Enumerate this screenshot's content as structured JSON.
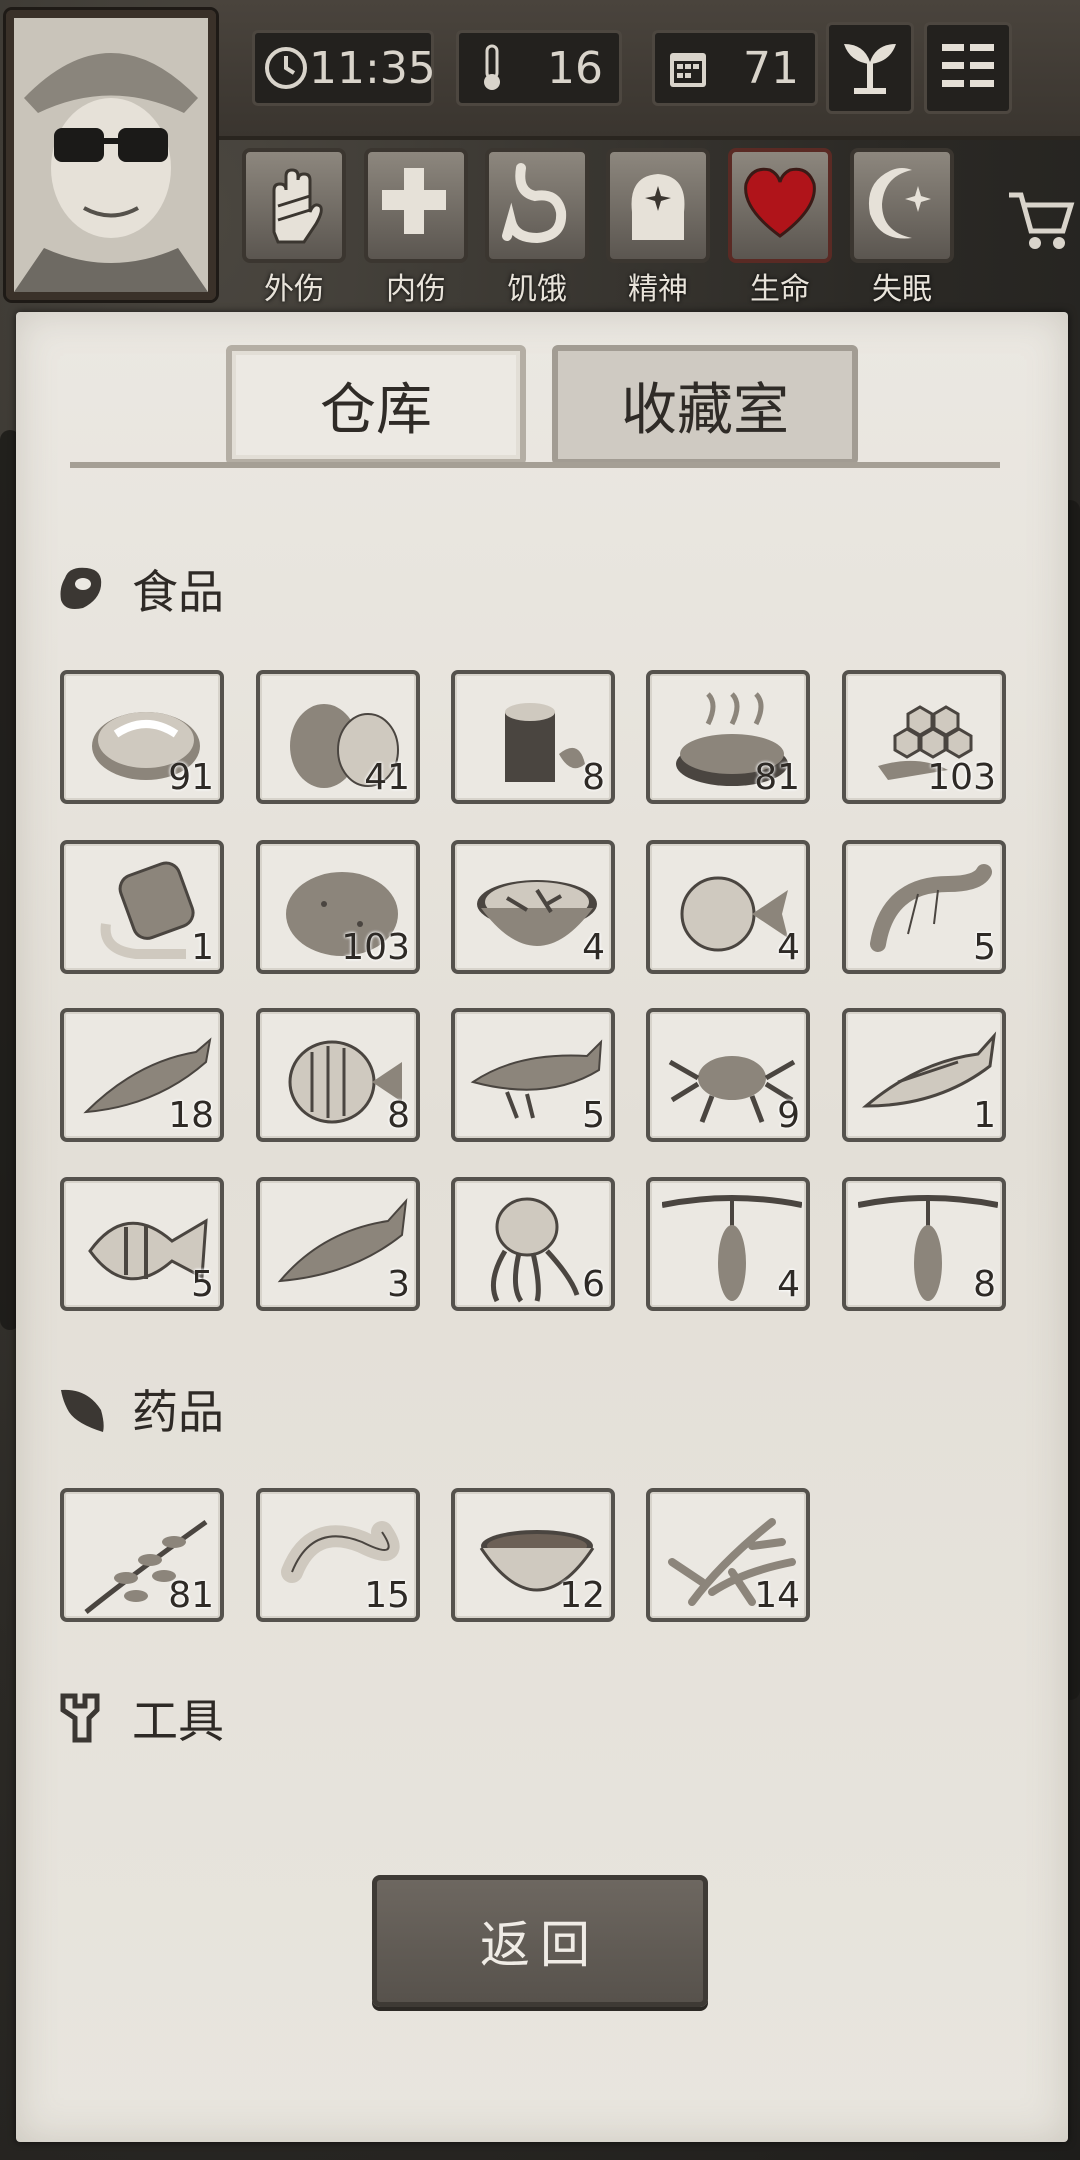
{
  "hud": {
    "time": "11:35",
    "temperature": "16",
    "day": "71",
    "icons": [
      "clock-icon",
      "thermometer-icon",
      "calendar-icon",
      "sprout-icon",
      "menu-icon"
    ]
  },
  "status_bar": [
    {
      "label": "外伤",
      "icon": "bandaged-hand-icon"
    },
    {
      "label": "内伤",
      "icon": "cross-icon"
    },
    {
      "label": "饥饿",
      "icon": "stomach-icon"
    },
    {
      "label": "精神",
      "icon": "head-sparkle-icon"
    },
    {
      "label": "生命",
      "icon": "heart-icon"
    },
    {
      "label": "失眠",
      "icon": "moon-star-icon"
    }
  ],
  "tabs": {
    "active": "仓库",
    "inactive": "收藏室"
  },
  "sections": {
    "food": {
      "title": "食品",
      "icon": "meat-icon",
      "items": [
        {
          "name": "steak",
          "count": "91"
        },
        {
          "name": "coconut",
          "count": "41"
        },
        {
          "name": "wood-log",
          "count": "8"
        },
        {
          "name": "grilled-meat",
          "count": "81"
        },
        {
          "name": "honeycomb",
          "count": "103"
        },
        {
          "name": "barrel",
          "count": "1"
        },
        {
          "name": "potato",
          "count": "103"
        },
        {
          "name": "bowl-of-food",
          "count": "4"
        },
        {
          "name": "pufferfish",
          "count": "4"
        },
        {
          "name": "shrimp",
          "count": "5"
        },
        {
          "name": "salmon",
          "count": "18"
        },
        {
          "name": "butterflyfish",
          "count": "8"
        },
        {
          "name": "catfish",
          "count": "5"
        },
        {
          "name": "crab",
          "count": "9"
        },
        {
          "name": "mackerel",
          "count": "1"
        },
        {
          "name": "angelfish",
          "count": "5"
        },
        {
          "name": "trout",
          "count": "3"
        },
        {
          "name": "octopus",
          "count": "6"
        },
        {
          "name": "hanging-fruit",
          "count": "4"
        },
        {
          "name": "hanging-fruit",
          "count": "8"
        }
      ]
    },
    "medicine": {
      "title": "药品",
      "icon": "leaf-icon",
      "items": [
        {
          "name": "herb",
          "count": "81"
        },
        {
          "name": "bandage",
          "count": "15"
        },
        {
          "name": "soup-bowl",
          "count": "12"
        },
        {
          "name": "ginseng",
          "count": "14"
        }
      ]
    },
    "tools": {
      "title": "工具",
      "icon": "wrench-icon",
      "items": []
    }
  },
  "back_button": "返回",
  "colors": {
    "paper": "#ebe8e2",
    "ink": "#3b3733",
    "heart": "#b0141a",
    "frame": "#55524d"
  }
}
